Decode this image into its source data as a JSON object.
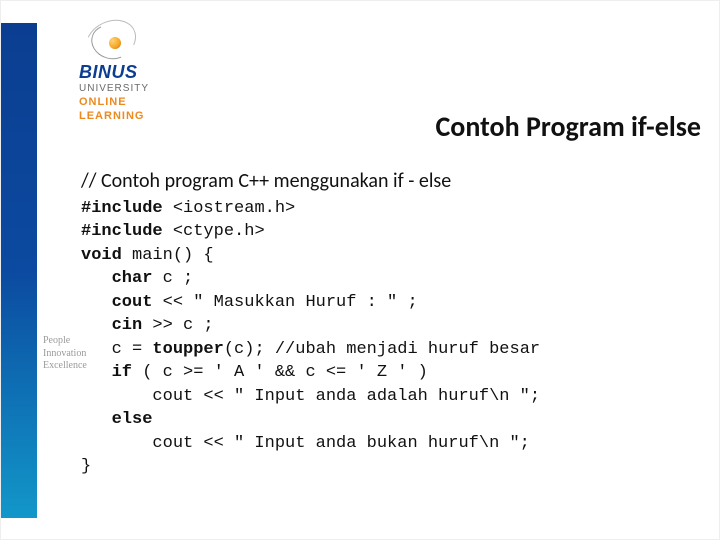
{
  "brand": {
    "name": "BINUS",
    "sub": "UNIVERSITY",
    "online1": "ONLINE",
    "online2": "LEARNING",
    "tagline1": "People",
    "tagline2": "Innovation",
    "tagline3": "Excellence"
  },
  "title": "Contoh Program if-else",
  "subtitle": "// Contoh program C++ menggunakan if - else",
  "code": {
    "l1a": "#include",
    "l1b": " <iostream.h>",
    "l2a": "#include",
    "l2b": " <ctype.h>",
    "l3a": "void",
    "l3b": " main() {",
    "l4a": "   char",
    "l4b": " c ;",
    "l5a": "   cout",
    "l5b": " << \" Masukkan Huruf : \" ;",
    "l6a": "   cin",
    "l6b": " >> c ;",
    "l7a": "   c = ",
    "l7b": "toupper",
    "l7c": "(c); //ubah menjadi huruf besar",
    "l8a": "   if",
    "l8b": " ( c >= ' A ' && c <= ' Z ' )",
    "l9": "       cout << \" Input anda adalah huruf\\n \";",
    "l10a": "   else",
    "l11": "       cout << \" Input anda bukan huruf\\n \";",
    "l12": "}"
  }
}
